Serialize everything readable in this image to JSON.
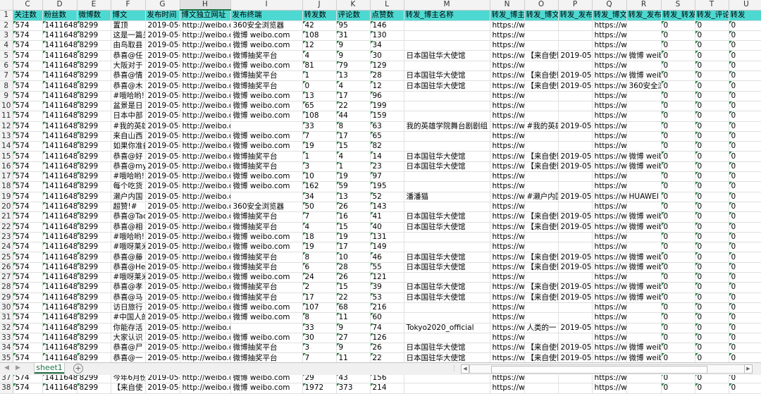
{
  "columns": [
    "C",
    "D",
    "E",
    "F",
    "G",
    "H",
    "I",
    "J",
    "K",
    "L",
    "M",
    "N",
    "O",
    "P",
    "Q",
    "R",
    "S",
    "T",
    "U"
  ],
  "selected_column": "H",
  "header_row": {
    "num": "1",
    "cells": [
      "关注数",
      "粉丝数",
      "微博数",
      "博文",
      "发布时间",
      "博文独立网址",
      "发布终端",
      "转发数",
      "评论数",
      "点赞数",
      "转发_博主名称",
      "转发_博主",
      "转发_博文",
      "转发_发布",
      "转发_博文",
      "转发_发布",
      "转发_转发",
      "转发_评论",
      "转发"
    ]
  },
  "rows": [
    {
      "num": "2",
      "cells": [
        "574",
        "1411648",
        "8299",
        "置顶",
        "2019-05-2",
        "http://weibo.co",
        "360安全浏览器",
        "42",
        "95",
        "146",
        "",
        "https://wei",
        "",
        "",
        "https://wei",
        "",
        "0",
        "0",
        "0"
      ]
    },
    {
      "num": "3",
      "cells": [
        "574",
        "1411648",
        "8299",
        "这是一篇关",
        "2019-05-2",
        "http://weibo.co",
        "微博 weibo.com",
        "108",
        "31",
        "130",
        "",
        "https://wei",
        "",
        "",
        "https://wei",
        "",
        "0",
        "0",
        "0"
      ]
    },
    {
      "num": "4",
      "cells": [
        "574",
        "1411648",
        "8299",
        "由鸟取县",
        "2019-05-2",
        "http://weibo.co",
        "微博 weibo.com",
        "12",
        "9",
        "34",
        "",
        "https://wei",
        "",
        "",
        "https://wei",
        "",
        "0",
        "0",
        "0"
      ]
    },
    {
      "num": "5",
      "cells": [
        "574",
        "1411648",
        "8299",
        "恭喜@任",
        "2019-05-2",
        "http://weibo.co",
        "微博抽奖平台",
        "4",
        "9",
        "30",
        "日本国驻华大使馆",
        "https://wei",
        "【来自使馆",
        "2019-05-2",
        "https://wei",
        "微博 weibo",
        "0",
        "0",
        "0"
      ]
    },
    {
      "num": "6",
      "cells": [
        "574",
        "1411648",
        "8299",
        "大阪对于",
        "2019-05-2",
        "http://weibo.co",
        "微博 weibo.com",
        "81",
        "79",
        "129",
        "",
        "https://wei",
        "",
        "",
        "https://wei",
        "",
        "0",
        "0",
        "0"
      ]
    },
    {
      "num": "7",
      "cells": [
        "574",
        "1411648",
        "8299",
        "恭喜@情",
        "2019-05-2",
        "http://weibo.co",
        "微博抽奖平台",
        "1",
        "13",
        "28",
        "日本国驻华大使馆",
        "https://wei",
        "【来自使馆",
        "2019-05-2",
        "https://wei",
        "微博 weibo",
        "0",
        "0",
        "0"
      ]
    },
    {
      "num": "8",
      "cells": [
        "574",
        "1411648",
        "8299",
        "恭喜@木",
        "2019-05-2",
        "http://weibo.co",
        "微博抽奖平台",
        "0",
        "4",
        "12",
        "日本国驻华大使馆",
        "https://wei",
        "【来自使馆",
        "2019-05-2",
        "https://wei",
        "360安全浏",
        "0",
        "0",
        "0"
      ]
    },
    {
      "num": "9",
      "cells": [
        "574",
        "1411648",
        "8299",
        "#哦哈哟!",
        "2019-05-2",
        "http://weibo.co",
        "微博 weibo.com",
        "13",
        "17",
        "96",
        "",
        "https://wei",
        "",
        "",
        "https://wei",
        "",
        "0",
        "0",
        "0"
      ]
    },
    {
      "num": "10",
      "cells": [
        "574",
        "1411648",
        "8299",
        "盆景是日",
        "2019-05-2",
        "http://weibo.co",
        "微博 weibo.com",
        "65",
        "22",
        "199",
        "",
        "https://wei",
        "",
        "",
        "https://wei",
        "",
        "0",
        "0",
        "0"
      ]
    },
    {
      "num": "11",
      "cells": [
        "574",
        "1411648",
        "8299",
        "日本中部",
        "2019-05-2",
        "http://weibo.co",
        "微博 weibo.com",
        "108",
        "44",
        "159",
        "",
        "https://wei",
        "",
        "",
        "https://wei",
        "",
        "0",
        "0",
        "0"
      ]
    },
    {
      "num": "12",
      "cells": [
        "574",
        "1411648",
        "8299",
        "#我的英雄",
        "2019-05-2",
        "http://weibo.co",
        "",
        "33",
        "8",
        "63",
        "我的英雄学院舞台剧剧组",
        "https://wei",
        "#我的英雄",
        "2019-05-2",
        "https://wei",
        "",
        "0",
        "0",
        "0"
      ]
    },
    {
      "num": "13",
      "cells": [
        "574",
        "1411648",
        "8299",
        "来自山西",
        "2019-05-2",
        "http://weibo.co",
        "微博 weibo.com",
        "7",
        "17",
        "65",
        "",
        "https://wei",
        "",
        "",
        "https://wei",
        "",
        "0",
        "0",
        "0"
      ]
    },
    {
      "num": "14",
      "cells": [
        "574",
        "1411648",
        "8299",
        "如果你准备",
        "2019-05-2",
        "http://weibo.co",
        "微博 weibo.com",
        "19",
        "15",
        "82",
        "",
        "https://wei",
        "",
        "",
        "https://wei",
        "",
        "0",
        "0",
        "0"
      ]
    },
    {
      "num": "15",
      "cells": [
        "574",
        "1411648",
        "8299",
        "恭喜@好",
        "2019-05-2",
        "http://weibo.co",
        "微博抽奖平台",
        "1",
        "4",
        "14",
        "日本国驻华大使馆",
        "https://wei",
        "【来自使馆",
        "2019-05-2",
        "https://wei",
        "微博 weibo",
        "0",
        "0",
        "0"
      ]
    },
    {
      "num": "16",
      "cells": [
        "574",
        "1411648",
        "8299",
        "恭喜@myt",
        "2019-05-2",
        "http://weibo.co",
        "微博抽奖平台",
        "3",
        "1",
        "23",
        "日本国驻华大使馆",
        "https://wei",
        "【来自使馆",
        "2019-05-2",
        "https://wei",
        "微博 weibo",
        "0",
        "0",
        "0"
      ]
    },
    {
      "num": "17",
      "cells": [
        "574",
        "1411648",
        "8299",
        "#哦哈哟!",
        "2019-05-2",
        "http://weibo.co",
        "微博 weibo.com",
        "10",
        "19",
        "97",
        "",
        "https://wei",
        "",
        "",
        "https://wei",
        "",
        "0",
        "0",
        "0"
      ]
    },
    {
      "num": "18",
      "cells": [
        "574",
        "1411648",
        "8299",
        "每个吃货",
        "2019-05-2",
        "http://weibo.co",
        "微博 weibo.com",
        "162",
        "59",
        "195",
        "",
        "https://wei",
        "",
        "",
        "https://wei",
        "",
        "0",
        "0",
        "0"
      ]
    },
    {
      "num": "19",
      "cells": [
        "574",
        "1411648",
        "8299",
        "濑户内国",
        "2019-05-2",
        "http://weibo.co",
        "",
        "34",
        "13",
        "52",
        "潘潘猫",
        "https://wei",
        "#濑户内国",
        "2019-05-2",
        "https://wei",
        "HUAWEI P",
        "0",
        "0",
        "0"
      ]
    },
    {
      "num": "20",
      "cells": [
        "574",
        "1411648",
        "8299",
        "超赞!#",
        "2019-05-2",
        "http://weibo.co",
        "360安全浏览器",
        "50",
        "26",
        "143",
        "",
        "https://wei",
        "",
        "",
        "https://wei",
        "",
        "0",
        "0",
        "0"
      ]
    },
    {
      "num": "21",
      "cells": [
        "574",
        "1411648",
        "8299",
        "恭喜@Tao",
        "2019-05-2",
        "http://weibo.co",
        "微博抽奖平台",
        "7",
        "16",
        "41",
        "日本国驻华大使馆",
        "https://wei",
        "【来自使馆",
        "2019-05-2",
        "https://wei",
        "微博 weibo",
        "0",
        "0",
        "0"
      ]
    },
    {
      "num": "22",
      "cells": [
        "574",
        "1411648",
        "8299",
        "恭喜@相",
        "2019-05-2",
        "http://weibo.co",
        "微博抽奖平台",
        "4",
        "15",
        "40",
        "日本国驻华大使馆",
        "https://wei",
        "【来自使馆",
        "2019-05-2",
        "https://wei",
        "微博 weibo",
        "0",
        "0",
        "0"
      ]
    },
    {
      "num": "23",
      "cells": [
        "574",
        "1411648",
        "8299",
        "#哦哈哟!",
        "2019-05-2",
        "http://weibo.co",
        "微博 weibo.com",
        "18",
        "19",
        "131",
        "",
        "https://wei",
        "",
        "",
        "https://wei",
        "",
        "0",
        "0",
        "0"
      ]
    },
    {
      "num": "24",
      "cells": [
        "574",
        "1411648",
        "8299",
        "#哦呀莱米",
        "2019-05-2",
        "http://weibo.co",
        "微博 weibo.com",
        "19",
        "17",
        "149",
        "",
        "https://wei",
        "",
        "",
        "https://wei",
        "",
        "0",
        "0",
        "0"
      ]
    },
    {
      "num": "25",
      "cells": [
        "574",
        "1411648",
        "8299",
        "恭喜@藤",
        "2019-05-2",
        "http://weibo.co",
        "微博抽奖平台",
        "8",
        "10",
        "46",
        "日本国驻华大使馆",
        "https://wei",
        "【来自使馆",
        "2019-05-1",
        "https://wei",
        "微博 weibo",
        "0",
        "0",
        "0"
      ]
    },
    {
      "num": "26",
      "cells": [
        "574",
        "1411648",
        "8299",
        "恭喜@Hei",
        "2019-05-2",
        "http://weibo.co",
        "微博抽奖平台",
        "6",
        "28",
        "55",
        "日本国驻华大使馆",
        "https://wei",
        "【来自使馆",
        "2019-05-1",
        "https://wei",
        "微博 weibo",
        "0",
        "0",
        "0"
      ]
    },
    {
      "num": "27",
      "cells": [
        "574",
        "1411648",
        "8299",
        "#哦呀莱米",
        "2019-05-2",
        "http://weibo.co",
        "微博 weibo.com",
        "24",
        "26",
        "121",
        "",
        "https://wei",
        "",
        "",
        "https://wei",
        "",
        "0",
        "0",
        "0"
      ]
    },
    {
      "num": "28",
      "cells": [
        "574",
        "1411648",
        "8299",
        "恭喜@孝",
        "2019-05-2",
        "http://weibo.co",
        "微博抽奖平台",
        "2",
        "15",
        "39",
        "日本国驻华大使馆",
        "https://wei",
        "【来自使馆",
        "2019-05-1",
        "https://wei",
        "微博 weibo",
        "0",
        "0",
        "0"
      ]
    },
    {
      "num": "29",
      "cells": [
        "574",
        "1411648",
        "8299",
        "恭喜@马",
        "2019-05-2",
        "http://weibo.co",
        "微博抽奖平台",
        "17",
        "22",
        "53",
        "日本国驻华大使馆",
        "https://wei",
        "【来自使馆",
        "2019-05-1",
        "https://wei",
        "微博 weibo",
        "0",
        "0",
        "0"
      ]
    },
    {
      "num": "30",
      "cells": [
        "574",
        "1411648",
        "8299",
        "访日旅行",
        "2019-05-2",
        "http://weibo.co",
        "微博 weibo.com",
        "107",
        "68",
        "216",
        "",
        "https://wei",
        "",
        "",
        "https://wei",
        "",
        "0",
        "0",
        "0"
      ]
    },
    {
      "num": "31",
      "cells": [
        "574",
        "1411648",
        "8299",
        "#中国人的",
        "2019-05-2",
        "http://weibo.co",
        "微博 weibo.com",
        "8",
        "11",
        "60",
        "",
        "https://wei",
        "",
        "",
        "https://wei",
        "",
        "0",
        "0",
        "0"
      ]
    },
    {
      "num": "32",
      "cells": [
        "574",
        "1411648",
        "8299",
        "你能存活",
        "2019-05-2",
        "http://weibo.co",
        "",
        "33",
        "9",
        "74",
        "Tokyo2020_official",
        "https://wei",
        "人类的一",
        "2019-05-1",
        "https://wei",
        "",
        "0",
        "0",
        "0"
      ]
    },
    {
      "num": "33",
      "cells": [
        "574",
        "1411648",
        "8299",
        "大家认识",
        "2019-05-2",
        "http://weibo.co",
        "微博 weibo.com",
        "30",
        "27",
        "126",
        "",
        "https://wei",
        "",
        "",
        "https://wei",
        "",
        "0",
        "0",
        "0"
      ]
    },
    {
      "num": "34",
      "cells": [
        "574",
        "1411648",
        "8299",
        "恭喜@尸",
        "2019-05-2",
        "http://weibo.co",
        "微博抽奖平台",
        "3",
        "9",
        "26",
        "日本国驻华大使馆",
        "https://wei",
        "【来自使馆",
        "2019-05-1",
        "https://wei",
        "微博 weibo",
        "0",
        "0",
        "0"
      ]
    },
    {
      "num": "35",
      "cells": [
        "574",
        "1411648",
        "8299",
        "恭喜@一",
        "2019-05-2",
        "http://weibo.co",
        "微博抽奖平台",
        "7",
        "11",
        "22",
        "日本国驻华大使馆",
        "https://wei",
        "【来自使馆",
        "2019-05-1",
        "https://wei",
        "微博 weibo",
        "0",
        "0",
        "0"
      ]
    },
    {
      "num": "36",
      "cells": [
        "574",
        "1411648",
        "8299",
        "#哦哈哟!",
        "2019-05-2",
        "http://weibo.co",
        "微博 weibo.com",
        "33",
        "28",
        "137",
        "",
        "https://wei",
        "",
        "",
        "https://wei",
        "",
        "0",
        "0",
        "0"
      ]
    },
    {
      "num": "37",
      "cells": [
        "574",
        "1411648",
        "8299",
        "今年6月份",
        "2019-05-2",
        "http://weibo.co",
        "微博 weibo.com",
        "29",
        "43",
        "156",
        "",
        "https://wei",
        "",
        "",
        "https://wei",
        "",
        "0",
        "0",
        "0"
      ]
    },
    {
      "num": "38",
      "cells": [
        "574",
        "1411648",
        "8299",
        "【来自使",
        "2019-05-2",
        "http://weibo.co",
        "微博 weibo.com",
        "1972",
        "373",
        "214",
        "",
        "https://wei",
        "",
        "",
        "https://wei",
        "",
        "0",
        "0",
        "0"
      ]
    }
  ],
  "sheet_tab": "sheet1",
  "add_sheet_icon": "plus-circle-icon",
  "nav_prev_icon": "triangle-left-icon",
  "nav_next_icon": "triangle-right-icon",
  "scroll_left_icon": "arrow-left-icon",
  "scroll_right_icon": "arrow-right-icon",
  "header_fill": "#4dd9d2",
  "accent": "#217346"
}
